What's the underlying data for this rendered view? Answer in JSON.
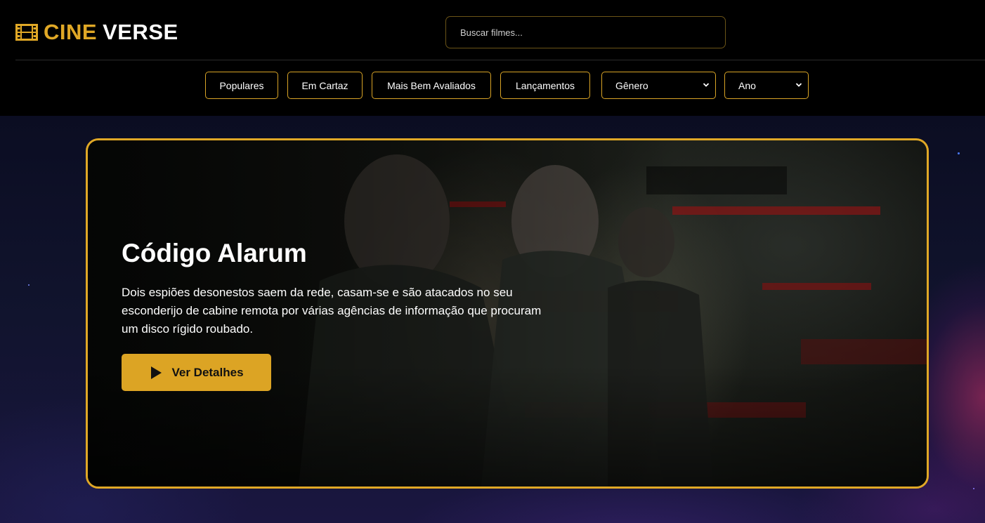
{
  "brand": {
    "name_part1": "CINE",
    "name_part2": "VERSE",
    "icon": "film-icon"
  },
  "search": {
    "placeholder": "Buscar filmes...",
    "value": ""
  },
  "nav": {
    "buttons": [
      "Populares",
      "Em Cartaz",
      "Mais Bem Avaliados",
      "Lançamentos"
    ],
    "genre_select": "Gênero",
    "year_select": "Ano"
  },
  "hero": {
    "title": "Código Alarum",
    "description": "Dois espiões desonestos saem da rede, casam-se e são atacados no seu esconderijo de cabine remota por várias agências de informação que procuram um disco rígido roubado.",
    "button_label": "Ver Detalhes",
    "button_icon": "play-icon"
  },
  "colors": {
    "accent": "#e0a826",
    "background": "#000000",
    "button_bg": "#dca424"
  }
}
